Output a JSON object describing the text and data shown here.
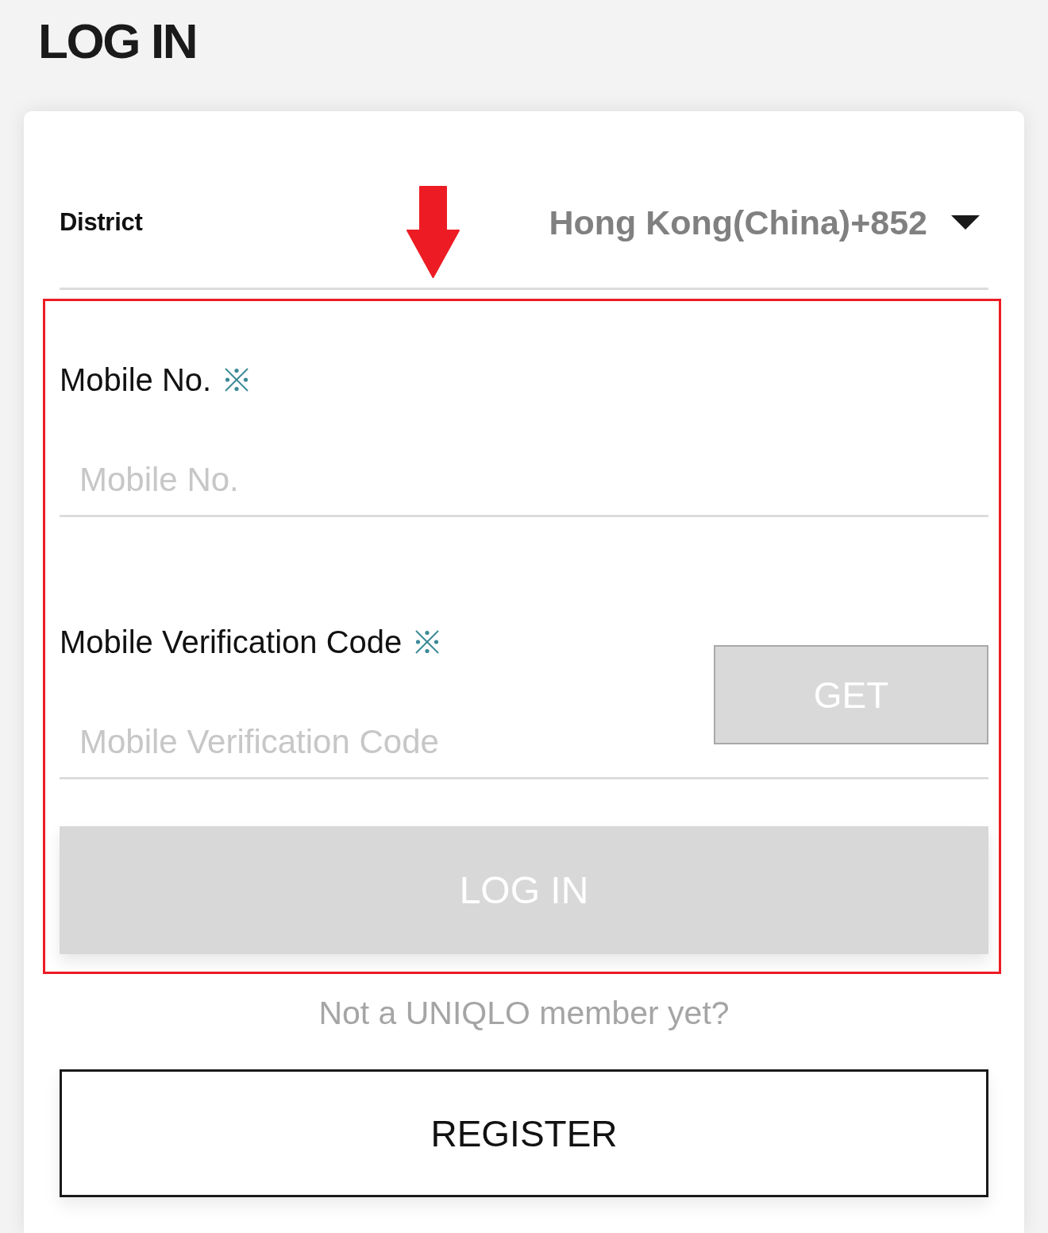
{
  "title": "LOG IN",
  "district": {
    "label": "District",
    "value": "Hong Kong(China)+852"
  },
  "fields": [
    {
      "label": "Mobile No.",
      "required": true,
      "placeholder": "Mobile No."
    },
    {
      "label": "Mobile Verification Code",
      "required": true,
      "placeholder": "Mobile Verification Code",
      "button": {
        "label": "GET",
        "disabled": true
      }
    }
  ],
  "login_button": {
    "label": "LOG IN",
    "disabled": true
  },
  "register_prompt": "Not a UNIQLO member yet?",
  "register_button": {
    "label": "REGISTER"
  },
  "annotations": {
    "arrow": true,
    "highlight": true
  }
}
